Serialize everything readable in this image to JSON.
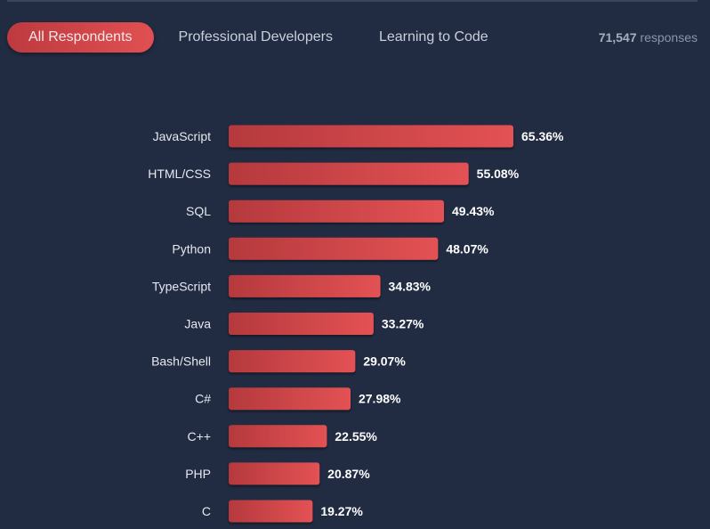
{
  "tabs": [
    {
      "label": "All Respondents",
      "active": true
    },
    {
      "label": "Professional Developers",
      "active": false
    },
    {
      "label": "Learning to Code",
      "active": false
    }
  ],
  "responses": {
    "count": "71,547",
    "label": "responses"
  },
  "colors": {
    "background": "#212b42",
    "bar_start": "#b5393d",
    "bar_end": "#e35254",
    "active_tab": "#d4464a"
  },
  "chart_data": {
    "type": "bar",
    "orientation": "horizontal",
    "title": "",
    "xlabel": "",
    "ylabel": "",
    "categories": [
      "JavaScript",
      "HTML/CSS",
      "SQL",
      "Python",
      "TypeScript",
      "Java",
      "Bash/Shell",
      "C#",
      "C++",
      "PHP",
      "C"
    ],
    "values": [
      65.36,
      55.08,
      49.43,
      48.07,
      34.83,
      33.27,
      29.07,
      27.98,
      22.55,
      20.87,
      19.27
    ],
    "value_labels": [
      "65.36%",
      "55.08%",
      "49.43%",
      "48.07%",
      "34.83%",
      "33.27%",
      "29.07%",
      "27.98%",
      "22.55%",
      "20.87%",
      "19.27%"
    ],
    "unit": "%",
    "xlim": [
      0,
      100
    ],
    "grid": false,
    "legend": "none"
  }
}
